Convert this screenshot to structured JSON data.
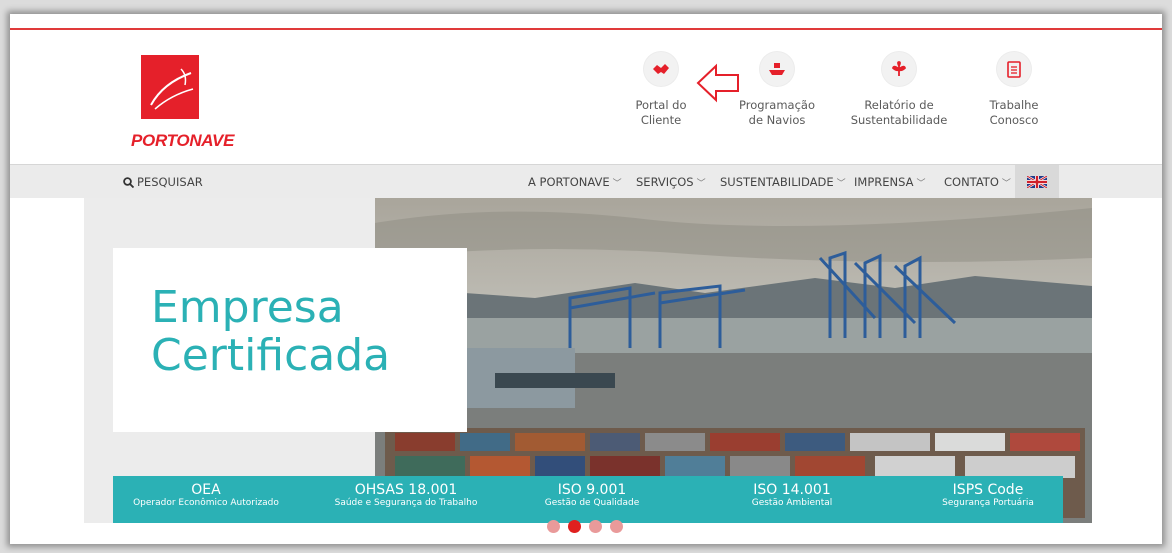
{
  "brand": {
    "name": "PORTONAVE",
    "color": "#e5202a"
  },
  "quick_links": [
    {
      "icon": "handshake-icon",
      "label": "Portal do\nCliente"
    },
    {
      "icon": "ship-icon",
      "label": "Programação\nde Navios"
    },
    {
      "icon": "leaf-icon",
      "label": "Relatório de\nSustentabilidade"
    },
    {
      "icon": "document-icon",
      "label": "Trabalhe\nConosco"
    }
  ],
  "nav": {
    "search_label": "PESQUISAR",
    "menu": [
      {
        "label": "A PORTONAVE"
      },
      {
        "label": "SERVIÇOS"
      },
      {
        "label": "SUSTENTABILIDADE"
      },
      {
        "label": "IMPRENSA"
      },
      {
        "label": "CONTATO"
      }
    ],
    "language_flag": "uk-flag-icon"
  },
  "hero": {
    "title": "Empresa\nCertificada",
    "certifications": [
      {
        "title": "OEA",
        "subtitle": "Operador Econômico Autorizado"
      },
      {
        "title": "OHSAS 18.001",
        "subtitle": "Saúde e Segurança do Trabalho"
      },
      {
        "title": "ISO 9.001",
        "subtitle": "Gestão de Qualidade"
      },
      {
        "title": "ISO 14.001",
        "subtitle": "Gestão Ambiental"
      },
      {
        "title": "ISPS Code",
        "subtitle": "Segurança Portuária"
      }
    ],
    "accent": "#2bb1b5",
    "slides_total": 4,
    "slide_active": 2
  }
}
